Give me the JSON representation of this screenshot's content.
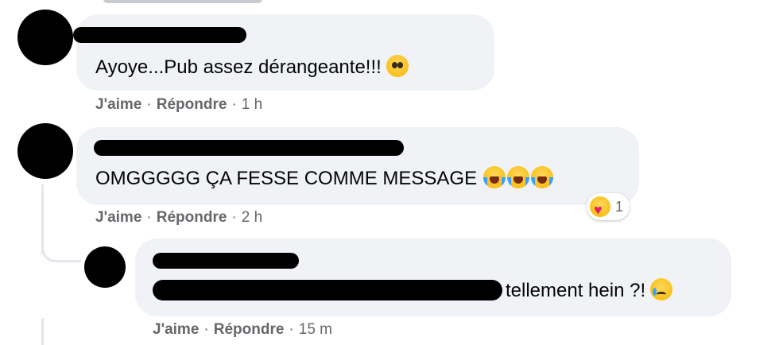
{
  "comments": [
    {
      "text": "Ayoye...Pub assez dérangeante!!!",
      "emojis": [
        "pleading-face-icon"
      ],
      "like": "J'aime",
      "reply": "Répondre",
      "time": "1 h"
    },
    {
      "text": "OMGGGGG ÇA FESSE COMME MESSAGE",
      "emojis": [
        "sob-face-icon",
        "sob-face-icon",
        "sob-face-icon"
      ],
      "like": "J'aime",
      "reply": "Répondre",
      "time": "2 h",
      "reaction": {
        "icon": "care-reaction-icon",
        "count": "1"
      }
    },
    {
      "text": "tellement hein ?!",
      "emojis": [
        "crying-face-icon"
      ],
      "like": "J'aime",
      "reply": "Répondre",
      "time": "15 m"
    }
  ],
  "separator": "·",
  "colors": {
    "bubble": "#f0f2f5",
    "meta_text": "#65676b",
    "text": "#050505"
  }
}
